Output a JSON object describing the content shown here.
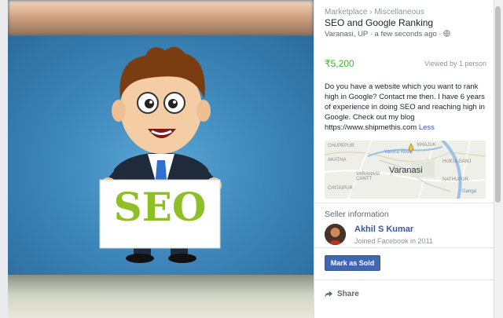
{
  "poster": {
    "sign_text": "SEO"
  },
  "listing": {
    "breadcrumb": "Marketplace › Miscellaneous",
    "title": "SEO and Google Ranking",
    "location": "Varanasi, UP · a few seconds ago ·",
    "price": "₹5,200",
    "viewed": "Viewed by 1 person",
    "description": "Do you have a website which you want to rank high in Google? Contact me then.  I have 6 years of experience in doing SEO and reaching high in Google. Check out my blog https://www.shipmethis.com",
    "less_link": "Less"
  },
  "map": {
    "city": "Varanasi",
    "labels": [
      "CHUPEPUR",
      "AKATHA",
      "Varuna River",
      "KHAJUK",
      "HUKULGANJ",
      "VARANASI CANTT",
      "CHITAIPUR",
      "NATHUPUR",
      "Ganga"
    ]
  },
  "seller": {
    "heading": "Seller information",
    "name": "Akhil S Kumar",
    "joined": "Joined Facebook in 2011"
  },
  "actions": {
    "mark_sold": "Mark as Sold",
    "share": "Share"
  },
  "icons": {
    "globe": "globe-icon",
    "share": "share-icon",
    "map_pin": "map-pin-icon"
  },
  "colors": {
    "brand_blue": "#4267b2",
    "price_green": "#42b72a",
    "link_blue": "#385898"
  }
}
